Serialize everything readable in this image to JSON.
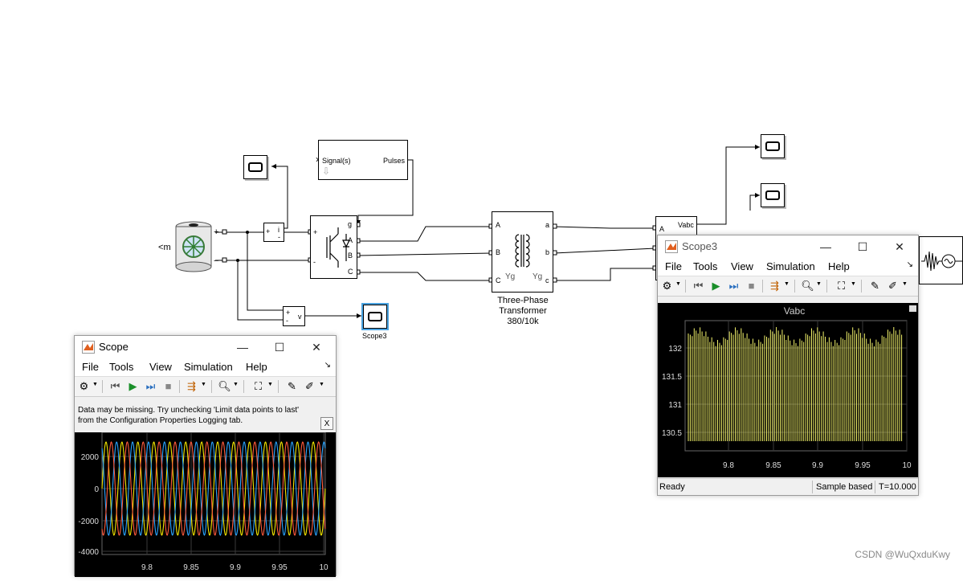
{
  "model": {
    "signal_block": {
      "input_label": "Signal(s)",
      "output_label": "Pulses"
    },
    "battery_port_label": "m",
    "plus_sign": "+",
    "minus_sign": "−",
    "current_meas": {
      "in_plus": "+",
      "in_minus": "-",
      "out": "i"
    },
    "voltage_meas": {
      "in_plus": "+",
      "in_minus": "-",
      "out": "v"
    },
    "bridge_ports": {
      "g": "g",
      "a": "A",
      "b": "B",
      "c": "C",
      "plus": "+",
      "minus": "-"
    },
    "transformer": {
      "port_A": "A",
      "port_B": "B",
      "port_C": "C",
      "port_a": "a",
      "port_b": "b",
      "port_c": "c",
      "wind1": "Yg",
      "wind2": "Yg",
      "caption1": "Three-Phase",
      "caption2": "Transformer",
      "caption3": "380/10k"
    },
    "vi_meas": {
      "output": "Vabc",
      "port_A": "A"
    },
    "scope3_block_label": "Scope3"
  },
  "scope_window": {
    "title": "Scope",
    "menu": [
      "File",
      "Tools",
      "View",
      "Simulation",
      "Help"
    ],
    "message": "Data may be missing.  Try unchecking 'Limit data points to last' from the Configuration Properties Logging tab.",
    "message_close": "X",
    "y_ticks": [
      "2000",
      "0",
      "-2000",
      "-4000"
    ],
    "x_ticks": [
      "9.8",
      "9.85",
      "9.9",
      "9.95",
      "10"
    ],
    "series_colors": [
      "#f2e600",
      "#2aa4ff",
      "#ff5a3c"
    ]
  },
  "scope3_window": {
    "title": "Scope3",
    "menu": [
      "File",
      "Tools",
      "View",
      "Simulation",
      "Help"
    ],
    "plot_title": "Vabc",
    "y_ticks": [
      "132",
      "131.5",
      "131",
      "130.5"
    ],
    "x_ticks": [
      "9.8",
      "9.85",
      "9.9",
      "9.95",
      "10"
    ],
    "status_left": "Ready",
    "status_mode": "Sample based",
    "status_time": "T=10.000",
    "series_color": "#f2f26a"
  },
  "window_buttons": {
    "minimize": "—",
    "maximize": "☐",
    "close": "✕"
  },
  "icons": [
    "matlab-icon",
    "gear-icon",
    "rewind-icon",
    "run-icon",
    "step-icon",
    "stop-icon",
    "signal-select-icon",
    "zoom-icon",
    "fit-icon",
    "style-icon",
    "edit-icon",
    "expand-icon"
  ],
  "watermark": "CSDN @WuQxduKwy"
}
